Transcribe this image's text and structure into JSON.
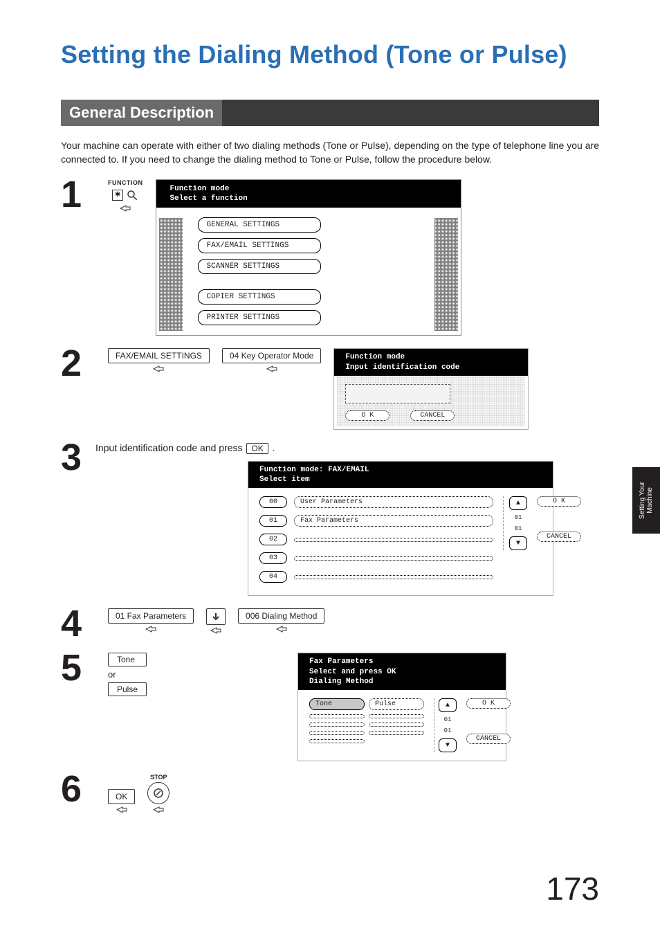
{
  "title": "Setting the Dialing Method (Tone or Pulse)",
  "section_heading": "General Description",
  "intro": "Your machine can operate with either of two dialing methods (Tone or Pulse), depending on the type of telephone line you are connected to.  If you need to change the dialing method to Tone or Pulse, follow the procedure below.",
  "steps": {
    "s1": {
      "num": "1",
      "function_label": "FUNCTION",
      "lcd": {
        "line1": "Function mode",
        "line2": "Select a function",
        "col1": [
          "GENERAL SETTINGS",
          "FAX/EMAIL SETTINGS",
          "SCANNER SETTINGS"
        ],
        "col2": [
          "COPIER SETTINGS",
          "PRINTER SETTINGS"
        ]
      }
    },
    "s2": {
      "num": "2",
      "btn1": "FAX/EMAIL SETTINGS",
      "btn2": "04 Key Operator Mode",
      "lcd": {
        "line1": "Function mode",
        "line2": "Input identification code",
        "ok": "O K",
        "cancel": "CANCEL"
      }
    },
    "s3": {
      "num": "3",
      "text_before": "Input identification code and press ",
      "ok": "OK",
      "text_after": ".",
      "lcd": {
        "line1": "Function mode: FAX/EMAIL",
        "line2": "Select item",
        "rows": [
          {
            "idx": "00",
            "label": "User Parameters"
          },
          {
            "idx": "01",
            "label": "Fax Parameters"
          },
          {
            "idx": "02",
            "label": ""
          },
          {
            "idx": "03",
            "label": ""
          },
          {
            "idx": "04",
            "label": ""
          }
        ],
        "page_top": "01",
        "page_bot": "01",
        "ok": "O K",
        "cancel": "CANCEL"
      }
    },
    "s4": {
      "num": "4",
      "btn1": "01 Fax Parameters",
      "btn2": "006 Dialing Method"
    },
    "s5": {
      "num": "5",
      "btn_tone": "Tone",
      "or": "or",
      "btn_pulse": "Pulse",
      "lcd": {
        "line1": "Fax Parameters",
        "line2": "Select and press OK",
        "line3": "Dialing Method",
        "opt_tone": "Tone",
        "opt_pulse": "Pulse",
        "page_top": "01",
        "page_bot": "01",
        "ok": "O K",
        "cancel": "CANCEL"
      }
    },
    "s6": {
      "num": "6",
      "ok": "OK",
      "stop": "STOP"
    }
  },
  "side_tab": {
    "line1": "Setting Your",
    "line2": "Machine"
  },
  "page_number": "173"
}
